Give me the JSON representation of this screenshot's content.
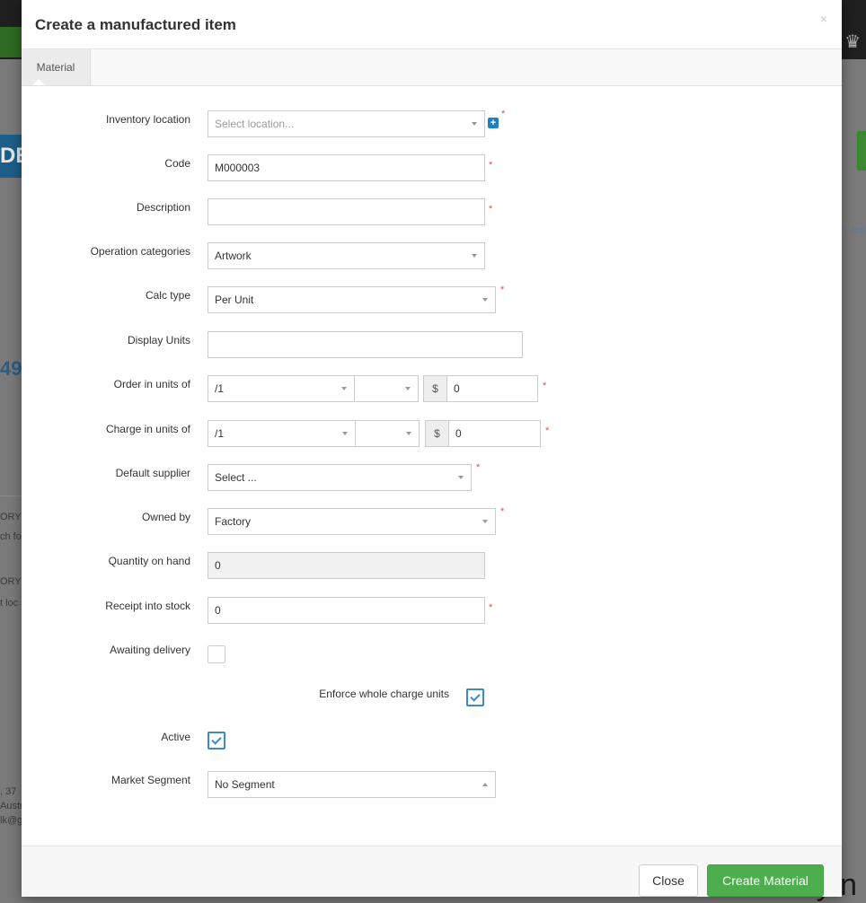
{
  "background": {
    "logo_fragment": "DE",
    "jobs_fragment": "t Job",
    "number_fragment": "49",
    "small_lines": [
      "ORY I",
      "ch fo",
      "ORY L",
      "t loc"
    ],
    "address_lines": [
      ", 37",
      "Austr",
      "lk@g"
    ],
    "big_fragment": "y n"
  },
  "modal": {
    "title": "Create a manufactured item",
    "close_glyph": "×",
    "tab_label": "Material"
  },
  "form": {
    "inventory_location": {
      "label": "Inventory location",
      "placeholder": "Select location..."
    },
    "code": {
      "label": "Code",
      "value": "M000003"
    },
    "description": {
      "label": "Description",
      "value": ""
    },
    "operation_categories": {
      "label": "Operation categories",
      "value": "Artwork"
    },
    "calc_type": {
      "label": "Calc type",
      "value": "Per Unit"
    },
    "display_units": {
      "label": "Display Units",
      "value": ""
    },
    "order_in_units_of": {
      "label": "Order in units of",
      "unit": "/1",
      "unit2": "",
      "currency": "$",
      "amount": "0"
    },
    "charge_in_units_of": {
      "label": "Charge in units of",
      "unit": "/1",
      "unit2": "",
      "currency": "$",
      "amount": "0"
    },
    "default_supplier": {
      "label": "Default supplier",
      "value": "Select ..."
    },
    "owned_by": {
      "label": "Owned by",
      "value": "Factory"
    },
    "quantity_on_hand": {
      "label": "Quantity on hand",
      "value": "0"
    },
    "receipt_into_stock": {
      "label": "Receipt into stock",
      "value": "0"
    },
    "awaiting_delivery": {
      "label": "Awaiting delivery",
      "checked": false
    },
    "enforce_whole_charge_units": {
      "label": "Enforce whole charge units",
      "checked": true
    },
    "active": {
      "label": "Active",
      "checked": true
    },
    "market_segment": {
      "label": "Market Segment",
      "value": "No Segment"
    },
    "required_marker": "*"
  },
  "footer": {
    "close_label": "Close",
    "create_label": "Create Material"
  },
  "colors": {
    "primary_green": "#4cae4c",
    "checkbox_blue": "#3d88c9",
    "required_red": "#d9534f"
  }
}
